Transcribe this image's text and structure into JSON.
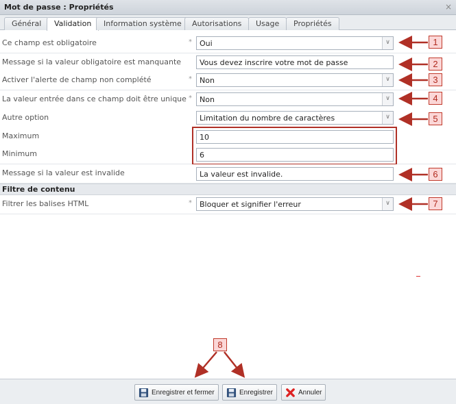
{
  "window": {
    "title": "Mot de passe : Propriétés",
    "close_glyph": "×"
  },
  "tabs": [
    {
      "label": "Général"
    },
    {
      "label": "Validation"
    },
    {
      "label": "Information système"
    },
    {
      "label": "Autorisations"
    },
    {
      "label": "Usage"
    },
    {
      "label": "Propriétés"
    }
  ],
  "active_tab": "Validation",
  "rows": {
    "required": {
      "label": "Ce champ est obligatoire",
      "req": "*",
      "value": "Oui"
    },
    "missing_msg": {
      "label": "Message si la valeur obligatoire est manquante",
      "value": "Vous devez inscrire votre mot de passe"
    },
    "alert": {
      "label": "Activer l'alerte de champ non complété",
      "req": "*",
      "value": "Non"
    },
    "unique": {
      "label": "La valeur entrée dans ce champ doit être unique",
      "req": "*",
      "value": "Non"
    },
    "other": {
      "label": "Autre option",
      "value": "Limitation du nombre de caractères"
    },
    "maximum": {
      "label": "Maximum",
      "value": "10"
    },
    "minimum": {
      "label": "Minimum",
      "value": "6"
    },
    "invalid_msg": {
      "label": "Message si la valeur est invalide",
      "value": "La valeur est invalide."
    }
  },
  "section_content_filter": {
    "label": "Filtre de contenu"
  },
  "html_filter": {
    "label": "Filtrer les balises HTML",
    "req": "*",
    "value": "Bloquer et signifier l'erreur"
  },
  "callouts": [
    "1",
    "2",
    "3",
    "4",
    "5",
    "6",
    "7",
    "8"
  ],
  "footer": {
    "save_close": "Enregistrer et fermer",
    "save": "Enregistrer",
    "cancel": "Annuler"
  },
  "colors": {
    "annotation_red": "#b03026",
    "select_arrow": "#777777"
  },
  "icons": [
    "close-icon",
    "chevron-down-icon",
    "save-close-icon",
    "save-icon",
    "cancel-x-icon"
  ]
}
